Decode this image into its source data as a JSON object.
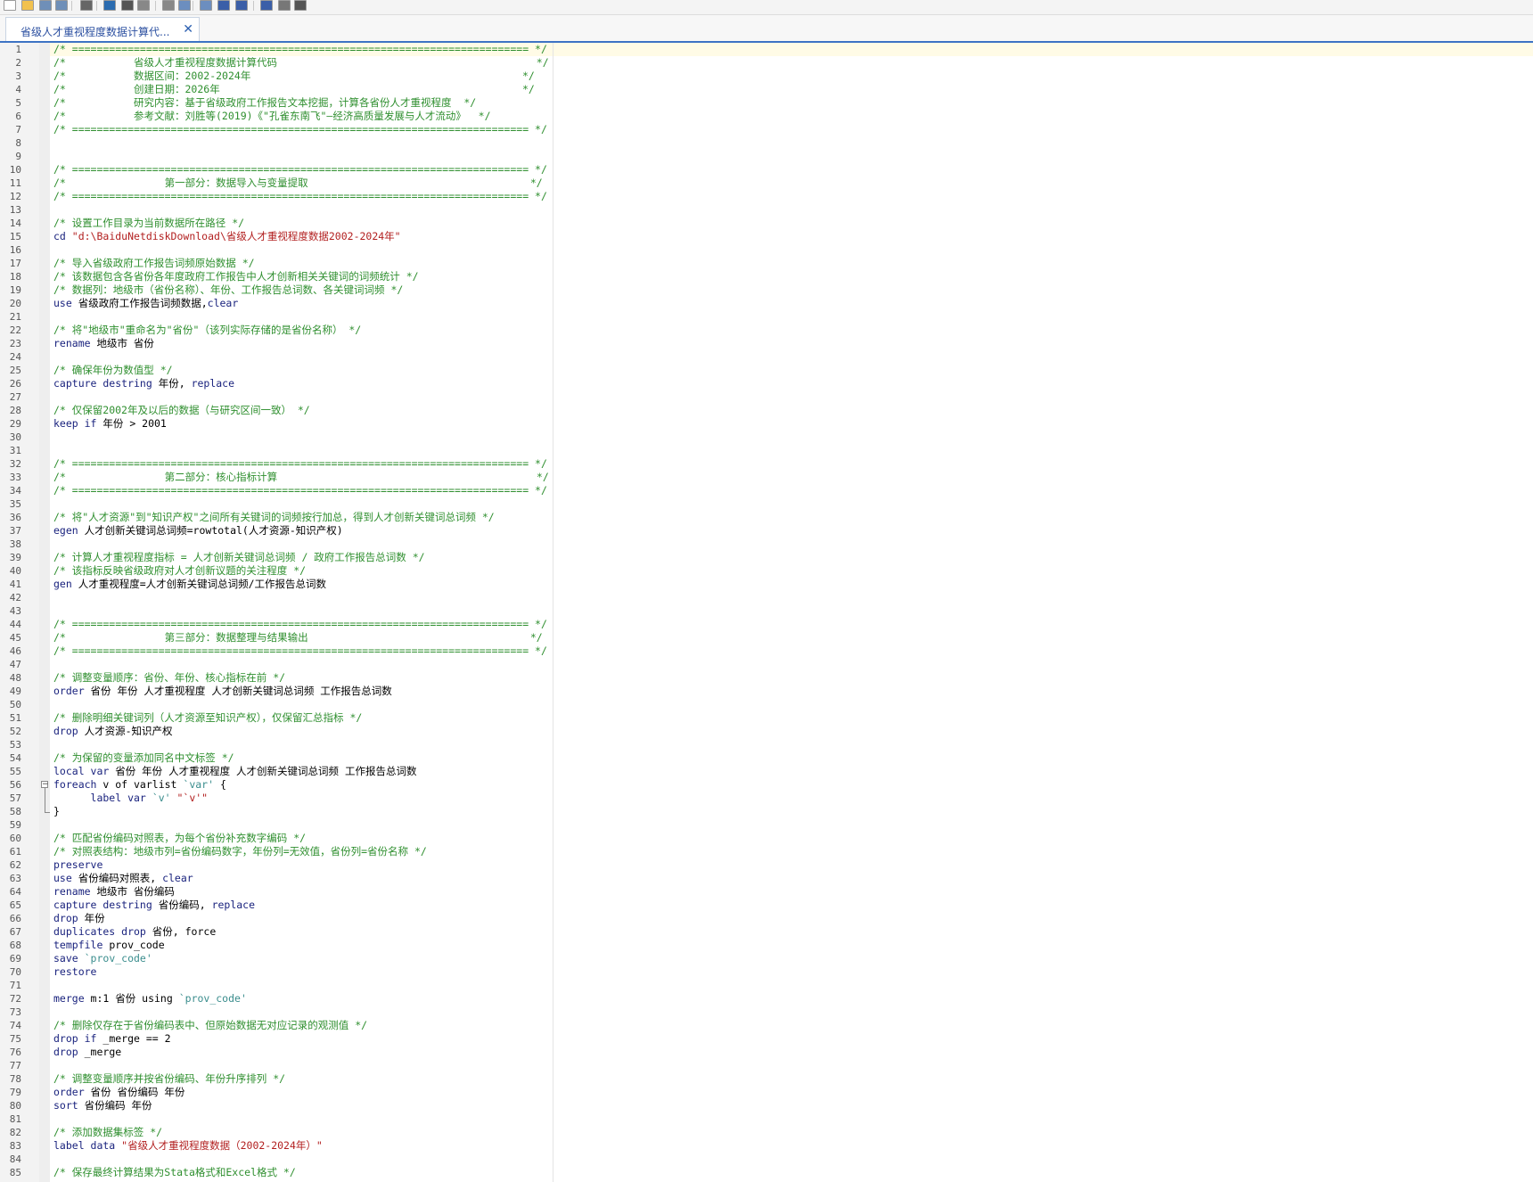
{
  "toolbar": {
    "icons": [
      "new-file-icon",
      "open-folder-icon",
      "save-icon",
      "save-all-icon",
      "print-icon",
      "find-icon",
      "cut-icon",
      "copy-icon",
      "paste-icon",
      "undo-icon",
      "redo-icon",
      "bookmark-icon",
      "bookmark-next-icon",
      "bookmark-prev-icon",
      "show-hide-icon",
      "run-file-icon"
    ]
  },
  "tab": {
    "title": "省级人才重视程度数据计算代..."
  },
  "editor": {
    "lines": [
      [
        {
          "t": "/* ========================================================================== */",
          "c": "cm"
        }
      ],
      [
        {
          "t": "/*           省级人才重视程度数据计算代码                                          */",
          "c": "cm"
        }
      ],
      [
        {
          "t": "/*           数据区间：2002-2024年                                            */",
          "c": "cm"
        }
      ],
      [
        {
          "t": "/*           创建日期：2026年                                                 */",
          "c": "cm"
        }
      ],
      [
        {
          "t": "/*           研究内容：基于省级政府工作报告文本挖掘，计算各省份人才重视程度  */",
          "c": "cm"
        }
      ],
      [
        {
          "t": "/*           参考文献：刘胜等(2019)《\"孔雀东南飞\"—经济高质量发展与人才流动》  */",
          "c": "cm"
        }
      ],
      [
        {
          "t": "/* ========================================================================== */",
          "c": "cm"
        }
      ],
      [],
      [],
      [
        {
          "t": "/* ========================================================================== */",
          "c": "cm"
        }
      ],
      [
        {
          "t": "/*                第一部分：数据导入与变量提取                                    */",
          "c": "cm"
        }
      ],
      [
        {
          "t": "/* ========================================================================== */",
          "c": "cm"
        }
      ],
      [],
      [
        {
          "t": "/* 设置工作目录为当前数据所在路径 */",
          "c": "cm"
        }
      ],
      [
        {
          "t": "cd ",
          "c": "kw"
        },
        {
          "t": "\"d:\\BaiduNetdiskDownload\\省级人才重视程度数据2002-2024年\"",
          "c": "st"
        }
      ],
      [],
      [
        {
          "t": "/* 导入省级政府工作报告词频原始数据 */",
          "c": "cm"
        }
      ],
      [
        {
          "t": "/* 该数据包含各省份各年度政府工作报告中人才创新相关关键词的词频统计 */",
          "c": "cm"
        }
      ],
      [
        {
          "t": "/* 数据列：地级市（省份名称）、年份、工作报告总词数、各关键词词频 */",
          "c": "cm"
        }
      ],
      [
        {
          "t": "use ",
          "c": "kw"
        },
        {
          "t": "省级政府工作报告词频数据,",
          "c": ""
        },
        {
          "t": "clear",
          "c": "kw"
        }
      ],
      [],
      [
        {
          "t": "/* 将\"地级市\"重命名为\"省份\"（该列实际存储的是省份名称） */",
          "c": "cm"
        }
      ],
      [
        {
          "t": "rename ",
          "c": "kw"
        },
        {
          "t": "地级市 省份",
          "c": ""
        }
      ],
      [],
      [
        {
          "t": "/* 确保年份为数值型 */",
          "c": "cm"
        }
      ],
      [
        {
          "t": "capture destring ",
          "c": "kw"
        },
        {
          "t": "年份, ",
          "c": ""
        },
        {
          "t": "replace",
          "c": "kw"
        }
      ],
      [],
      [
        {
          "t": "/* 仅保留2002年及以后的数据（与研究区间一致） */",
          "c": "cm"
        }
      ],
      [
        {
          "t": "keep if ",
          "c": "kw"
        },
        {
          "t": "年份 > 2001",
          "c": ""
        }
      ],
      [],
      [],
      [
        {
          "t": "/* ========================================================================== */",
          "c": "cm"
        }
      ],
      [
        {
          "t": "/*                第二部分：核心指标计算                                          */",
          "c": "cm"
        }
      ],
      [
        {
          "t": "/* ========================================================================== */",
          "c": "cm"
        }
      ],
      [],
      [
        {
          "t": "/* 将\"人才资源\"到\"知识产权\"之间所有关键词的词频按行加总，得到人才创新关键词总词频 */",
          "c": "cm"
        }
      ],
      [
        {
          "t": "egen ",
          "c": "kw"
        },
        {
          "t": "人才创新关键词总词频=rowtotal(人才资源-知识产权)",
          "c": ""
        }
      ],
      [],
      [
        {
          "t": "/* 计算人才重视程度指标 = 人才创新关键词总词频 / 政府工作报告总词数 */",
          "c": "cm"
        }
      ],
      [
        {
          "t": "/* 该指标反映省级政府对人才创新议题的关注程度 */",
          "c": "cm"
        }
      ],
      [
        {
          "t": "gen ",
          "c": "kw"
        },
        {
          "t": "人才重视程度=人才创新关键词总词频/工作报告总词数",
          "c": ""
        }
      ],
      [],
      [],
      [
        {
          "t": "/* ========================================================================== */",
          "c": "cm"
        }
      ],
      [
        {
          "t": "/*                第三部分：数据整理与结果输出                                    */",
          "c": "cm"
        }
      ],
      [
        {
          "t": "/* ========================================================================== */",
          "c": "cm"
        }
      ],
      [],
      [
        {
          "t": "/* 调整变量顺序：省份、年份、核心指标在前 */",
          "c": "cm"
        }
      ],
      [
        {
          "t": "order ",
          "c": "kw"
        },
        {
          "t": "省份 年份 人才重视程度 人才创新关键词总词频 工作报告总词数",
          "c": ""
        }
      ],
      [],
      [
        {
          "t": "/* 删除明细关键词列（人才资源至知识产权），仅保留汇总指标 */",
          "c": "cm"
        }
      ],
      [
        {
          "t": "drop ",
          "c": "kw"
        },
        {
          "t": "人才资源-知识产权",
          "c": ""
        }
      ],
      [],
      [
        {
          "t": "/* 为保留的变量添加同名中文标签 */",
          "c": "cm"
        }
      ],
      [
        {
          "t": "local var ",
          "c": "kw"
        },
        {
          "t": "省份 年份 人才重视程度 人才创新关键词总词频 工作报告总词数",
          "c": ""
        }
      ],
      [
        {
          "t": "foreach ",
          "c": "kw"
        },
        {
          "t": "v of varlist ",
          "c": ""
        },
        {
          "t": "`var'",
          "c": "mc"
        },
        {
          "t": " {",
          "c": ""
        }
      ],
      [
        {
          "t": "      label var ",
          "c": "kw"
        },
        {
          "t": "`v'",
          "c": "mc"
        },
        {
          "t": " \"`v'\"",
          "c": "st"
        }
      ],
      [
        {
          "t": "}",
          "c": ""
        }
      ],
      [],
      [
        {
          "t": "/* 匹配省份编码对照表，为每个省份补充数字编码 */",
          "c": "cm"
        }
      ],
      [
        {
          "t": "/* 对照表结构：地级市列=省份编码数字，年份列=无效值，省份列=省份名称 */",
          "c": "cm"
        }
      ],
      [
        {
          "t": "preserve",
          "c": "kw"
        }
      ],
      [
        {
          "t": "use ",
          "c": "kw"
        },
        {
          "t": "省份编码对照表, ",
          "c": ""
        },
        {
          "t": "clear",
          "c": "kw"
        }
      ],
      [
        {
          "t": "rename ",
          "c": "kw"
        },
        {
          "t": "地级市 省份编码",
          "c": ""
        }
      ],
      [
        {
          "t": "capture destring ",
          "c": "kw"
        },
        {
          "t": "省份编码, ",
          "c": ""
        },
        {
          "t": "replace",
          "c": "kw"
        }
      ],
      [
        {
          "t": "drop ",
          "c": "kw"
        },
        {
          "t": "年份",
          "c": ""
        }
      ],
      [
        {
          "t": "duplicates drop ",
          "c": "kw"
        },
        {
          "t": "省份, force",
          "c": ""
        }
      ],
      [
        {
          "t": "tempfile ",
          "c": "kw"
        },
        {
          "t": "prov_code",
          "c": ""
        }
      ],
      [
        {
          "t": "save ",
          "c": "kw"
        },
        {
          "t": "`prov_code'",
          "c": "mc"
        }
      ],
      [
        {
          "t": "restore",
          "c": "kw"
        }
      ],
      [],
      [
        {
          "t": "merge ",
          "c": "kw"
        },
        {
          "t": "m:1 省份 using ",
          "c": ""
        },
        {
          "t": "`prov_code'",
          "c": "mc"
        }
      ],
      [],
      [
        {
          "t": "/* 删除仅存在于省份编码表中、但原始数据无对应记录的观测值 */",
          "c": "cm"
        }
      ],
      [
        {
          "t": "drop if ",
          "c": "kw"
        },
        {
          "t": "_merge == 2",
          "c": ""
        }
      ],
      [
        {
          "t": "drop ",
          "c": "kw"
        },
        {
          "t": "_merge",
          "c": ""
        }
      ],
      [],
      [
        {
          "t": "/* 调整变量顺序并按省份编码、年份升序排列 */",
          "c": "cm"
        }
      ],
      [
        {
          "t": "order ",
          "c": "kw"
        },
        {
          "t": "省份 省份编码 年份",
          "c": ""
        }
      ],
      [
        {
          "t": "sort ",
          "c": "kw"
        },
        {
          "t": "省份编码 年份",
          "c": ""
        }
      ],
      [],
      [
        {
          "t": "/* 添加数据集标签 */",
          "c": "cm"
        }
      ],
      [
        {
          "t": "label data ",
          "c": "kw"
        },
        {
          "t": "\"省级人才重视程度数据（2002-2024年）\"",
          "c": "st"
        }
      ],
      [],
      [
        {
          "t": "/* 保存最终计算结果为Stata格式和Excel格式 */",
          "c": "cm"
        }
      ]
    ]
  }
}
